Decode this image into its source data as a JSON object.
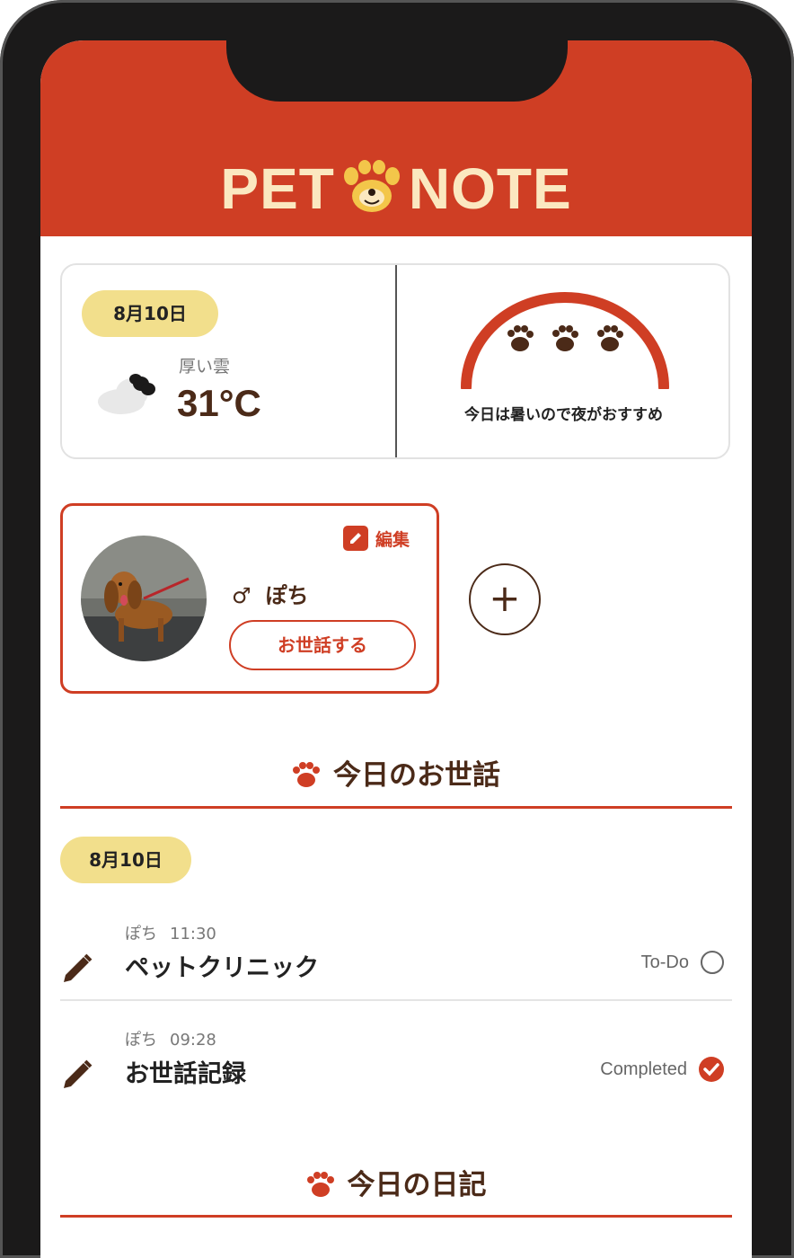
{
  "app": {
    "logo_left": "PET",
    "logo_right": "NOTE"
  },
  "colors": {
    "brand": "#cf3e24",
    "brown": "#4b2a18",
    "pill": "#f2df8c",
    "logo_text": "#fbe8c0"
  },
  "weather": {
    "date": "8月10日",
    "condition": "厚い雲",
    "temperature": "31°C",
    "icon": "cloud-icon",
    "walk_level": 3,
    "walk_level_max": 3,
    "walk_advice": "今日は暑いので夜がおすすめ"
  },
  "pet": {
    "edit_label": "編集",
    "gender_symbol": "♂",
    "name": "ぽち",
    "care_button": "お世話する",
    "add_button": "+"
  },
  "today_care": {
    "title": "今日のお世話",
    "date": "8月10日",
    "items": [
      {
        "pet": "ぽち",
        "time": "11:30",
        "title": "ペットクリニック",
        "status": "To-Do",
        "done": false
      },
      {
        "pet": "ぽち",
        "time": "09:28",
        "title": "お世話記録",
        "status": "Completed",
        "done": true
      }
    ]
  },
  "diary": {
    "title": "今日の日記"
  }
}
